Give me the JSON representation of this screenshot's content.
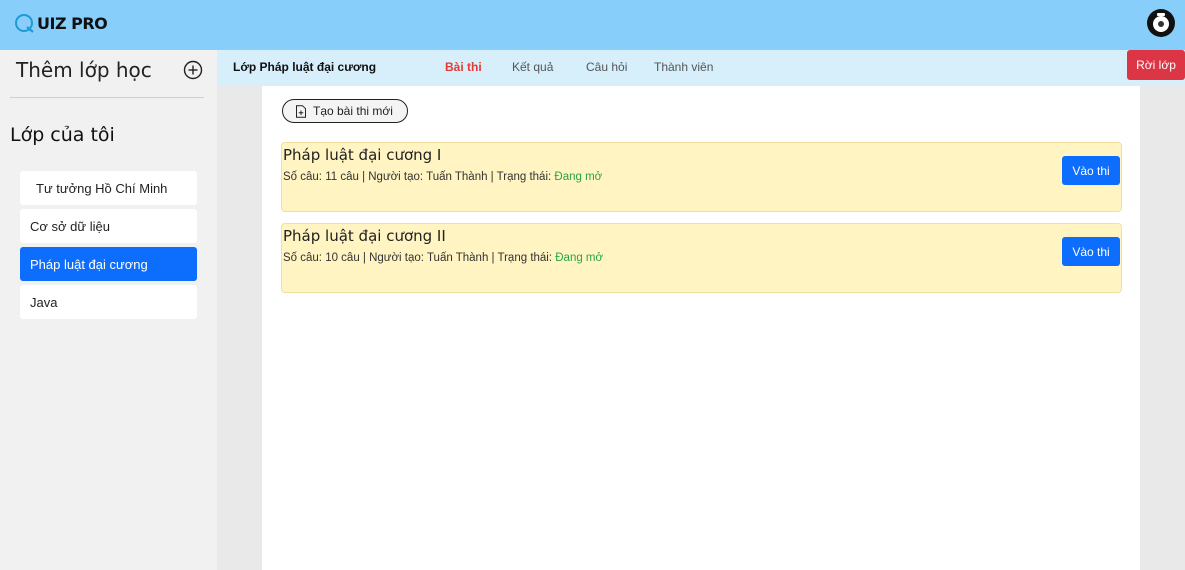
{
  "app": {
    "logo_letter": "Q",
    "logo_rest": "UIZ PRO"
  },
  "sidebar": {
    "add_class_label": "Thêm lớp học",
    "my_classes_title": "Lớp của tôi",
    "classes": [
      {
        "label": "Tư tưởng Hồ Chí Minh",
        "active": false
      },
      {
        "label": "Cơ sở dữ liệu",
        "active": false
      },
      {
        "label": "Pháp luật đại cương",
        "active": true
      },
      {
        "label": "Java",
        "active": false
      }
    ]
  },
  "tabbar": {
    "class_name": "Lớp Pháp luật đại cương",
    "tabs": [
      {
        "label": "Bài thi",
        "active": true
      },
      {
        "label": "Kết quả",
        "active": false
      },
      {
        "label": "Câu hỏi",
        "active": false
      },
      {
        "label": "Thành viên",
        "active": false
      }
    ],
    "leave_label": "Rời lớp"
  },
  "main": {
    "create_exam_label": "Tạo bài thi mới",
    "exams": [
      {
        "title": "Pháp luật đại cương I",
        "meta_prefix": "Số câu: 11 câu | Người tạo: Tuấn Thành | Trạng thái: ",
        "status": "Đang mở",
        "enter_label": "Vào thi"
      },
      {
        "title": "Pháp luật đại cương II",
        "meta_prefix": "Số câu: 10 câu | Người tạo: Tuấn Thành | Trạng thái: ",
        "status": "Đang mở",
        "enter_label": "Vào thi"
      }
    ]
  },
  "colors": {
    "header": "#87cefa",
    "accent": "#0d6efd",
    "danger": "#dc3545",
    "status_open": "#28a745",
    "card": "#fff4c2"
  }
}
